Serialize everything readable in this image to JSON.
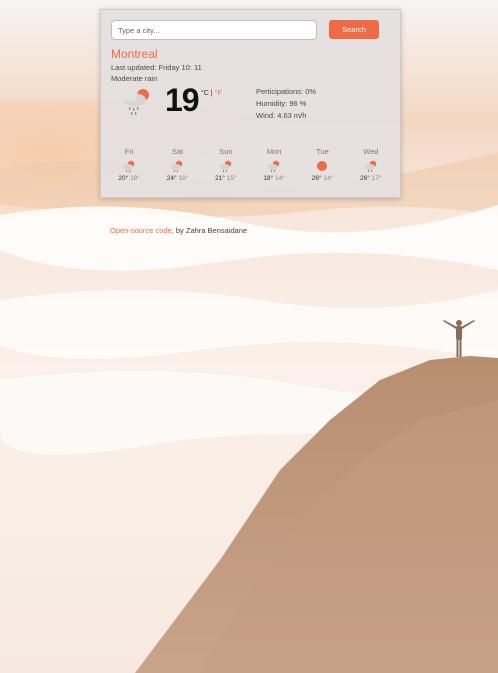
{
  "search": {
    "placeholder": "Type a city...",
    "button_label": "Search"
  },
  "current": {
    "city": "Montreal",
    "last_updated": "Last updated: Friday 10: 11",
    "description": "Moderate rain",
    "icon": "rain-cloud-sun-icon",
    "temperature": "19",
    "unit_c": "°C",
    "unit_sep": " | ",
    "unit_f": "°F",
    "precipitation": "Perticipations: 0%",
    "humidity": "Humidity: 96 %",
    "wind": "Wind: 4.63 m/h"
  },
  "forecast": [
    {
      "day": "Fri",
      "max": "20°",
      "min": "18°",
      "icon": "rain-sun-icon"
    },
    {
      "day": "Sat",
      "max": "24°",
      "min": "18°",
      "icon": "rain-sun-icon"
    },
    {
      "day": "Sun",
      "max": "21°",
      "min": "15°",
      "icon": "rain-sun-icon"
    },
    {
      "day": "Mon",
      "max": "18°",
      "min": "14°",
      "icon": "rain-sun-icon"
    },
    {
      "day": "Tue",
      "max": "26°",
      "min": "14°",
      "icon": "sun-icon"
    },
    {
      "day": "Wed",
      "max": "26°",
      "min": "17°",
      "icon": "rain-sun-icon"
    }
  ],
  "footer": {
    "link_text": "Open-source code",
    "suffix": ", by Zahra Bensaidane"
  },
  "colors": {
    "accent": "#ee6c45",
    "card": "#e4e0e0",
    "mountain": "#b89070"
  }
}
